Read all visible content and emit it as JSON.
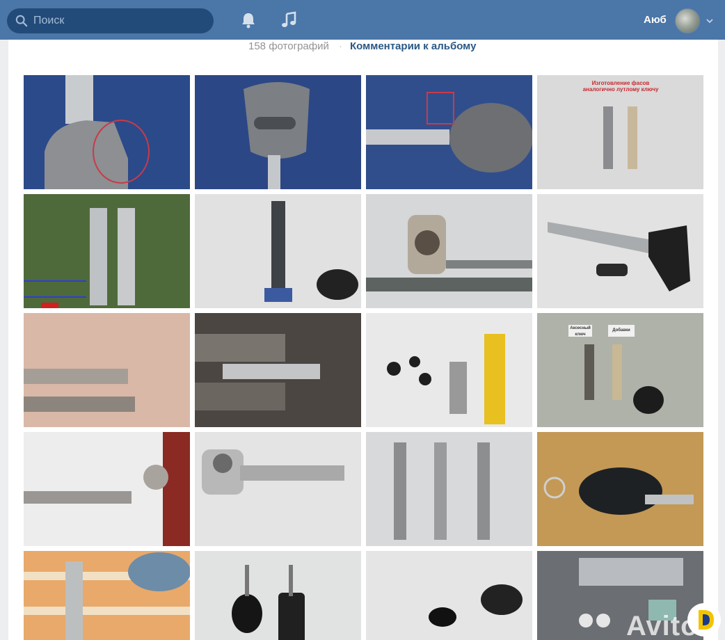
{
  "header": {
    "search_placeholder": "Поиск",
    "user_name": "Аюб",
    "icons": [
      "search-icon",
      "bell-icon",
      "music-icon",
      "chevron-down-icon"
    ],
    "colors": {
      "bar": "#4a76a8",
      "search_bg": "#224b7a"
    }
  },
  "album": {
    "photo_count": "158 фотографий",
    "separator": "·",
    "comments_link": "Комментарии к альбому"
  },
  "photos": {
    "label_mazda": "Изготовление фасов аналогично лутлому ключу",
    "label_left_key": "Аксесный ключ",
    "label_right_key": "Добавки"
  },
  "watermark": {
    "text": "Avito"
  }
}
